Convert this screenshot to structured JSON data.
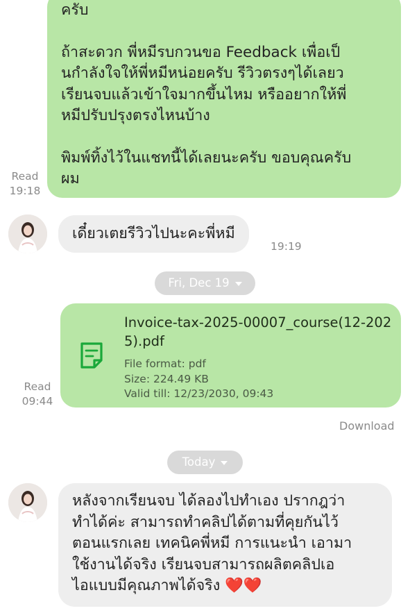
{
  "messages": {
    "first_outgoing": {
      "paragraphs": [
        "ครับ",
        "ถ้าสะดวก พี่หมีรบกวนขอ Feedback เพื่อเป็\nนกำลังใจให้พี่หมีหน่อยครับ รีวิวตรงๆได้เลยว\nเรียนจบแล้วเข้าใจมากขึ้นไหม หรืออยากให้พี่\nหมีปรับปรุงตรงไหนบ้าง",
        "พิมพ์ทิ้งไว้ในแชทนี้ได้เลยนะครับ ขอบคุณครับ\nผม"
      ],
      "read_label": "Read",
      "time": "19:18"
    },
    "first_incoming": {
      "text": "เดี๋ยวเตยรีวิวไปนะคะพี่หมี",
      "time": "19:19"
    },
    "date_divider_1": "Fri, Dec 19",
    "file_message": {
      "icon": "document-icon",
      "title_line1": "Invoice-tax-2025-00007_course(12-202",
      "title_line2": "5).pdf",
      "format": "File format: pdf",
      "size": "Size: 224.49 KB",
      "valid": "Valid till: 12/23/2030, 09:43",
      "read_label": "Read",
      "time": "09:44",
      "download_label": "Download"
    },
    "date_divider_2": "Today",
    "second_incoming": {
      "text": "หลังจากเรียนจบ ได้ลองไปทำเอง ปรากฎว่า\nทำได้ค่ะ สามารถทำคลิปได้ตามที่คุยกันไว้\nตอนแรกเลย เทคนิคพี่หมี การแนะนำ เอามา\nใช้งานได้จริง เรียนจบสามารถผลิตคลิปเอ\nไอแบบมีคุณภาพได้จริง ❤️❤️"
    }
  },
  "colors": {
    "outgoing_bubble": "#b8e6a6",
    "incoming_bubble": "#eeeeee",
    "file_icon": "#1aa83a",
    "date_pill": "#d9d9d9"
  }
}
